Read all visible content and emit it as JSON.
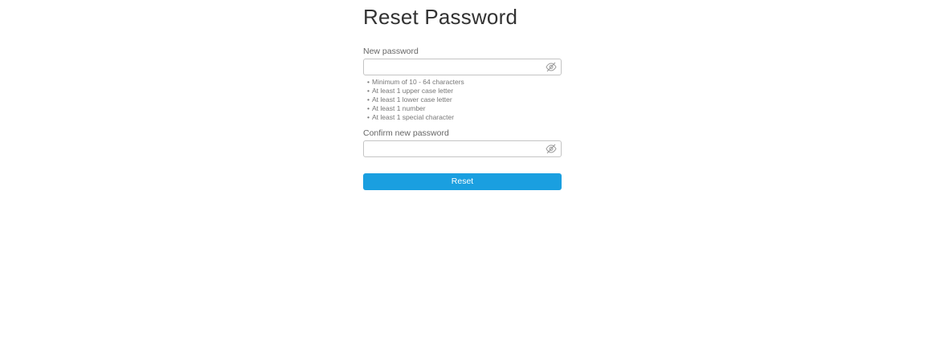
{
  "page": {
    "title": "Reset Password"
  },
  "new_password": {
    "label": "New password",
    "value": "",
    "placeholder": "",
    "toggle_icon": "eye-slash-icon"
  },
  "requirements": [
    "Minimum of 10 - 64 characters",
    "At least 1 upper case letter",
    "At least 1 lower case letter",
    "At least 1 number",
    "At least 1 special character"
  ],
  "confirm_password": {
    "label": "Confirm new password",
    "value": "",
    "placeholder": "",
    "toggle_icon": "eye-slash-icon"
  },
  "actions": {
    "reset_label": "Reset"
  },
  "colors": {
    "primary_button": "#1a9fe0",
    "border": "#c4c4c4",
    "title_text": "#333333"
  }
}
